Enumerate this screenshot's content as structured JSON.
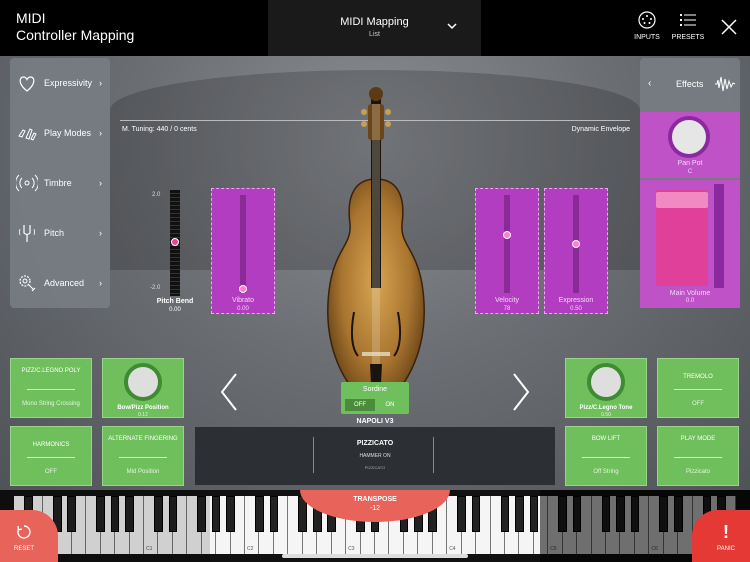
{
  "header": {
    "title_line1": "MIDI",
    "title_line2": "Controller Mapping",
    "mapping_title": "MIDI Mapping",
    "mapping_sub": "List",
    "inputs_label": "INPUTS",
    "presets_label": "PRESETS"
  },
  "left_panel": {
    "items": [
      {
        "label": "Expressivity",
        "icon": "heart-icon"
      },
      {
        "label": "Play Modes",
        "icon": "hands-icon"
      },
      {
        "label": "Timbre",
        "icon": "wave-radio-icon"
      },
      {
        "label": "Pitch",
        "icon": "tuning-fork-icon"
      },
      {
        "label": "Advanced",
        "icon": "advanced-gear-icon"
      }
    ]
  },
  "right_panel": {
    "title": "Effects",
    "panpot_label": "Pan Pot",
    "panpot_value": "C",
    "mainvol_label": "Main Volume",
    "mainvol_value": "0.0"
  },
  "stage": {
    "tuning": "M. Tuning: 440   / 0 cents",
    "dynamic_envelope": "Dynamic Envelope"
  },
  "pitch_bend": {
    "max": "2.0",
    "min": "-2.0",
    "label": "Pitch Bend",
    "value": "0.00"
  },
  "sliders": [
    {
      "label": "Vibrato",
      "value": "0.00",
      "level": 0.0
    },
    {
      "label": "Velocity",
      "value": "78",
      "level": 0.6
    },
    {
      "label": "Expression",
      "value": "0.50",
      "level": 0.5
    }
  ],
  "sordine": {
    "label": "Sordine",
    "off": "OFF",
    "on": "ON"
  },
  "preset_name": "NAPOLI V3",
  "left_buttons": [
    {
      "title": "PIZZ/C.LEGNO POLY",
      "value": "Mono String Crossing"
    },
    {
      "title": "HARMONICS",
      "value": "OFF"
    },
    {
      "title": "ALTERNATE FINGERING",
      "value": "Mid Position"
    }
  ],
  "left_knob": {
    "label": "Bow/Pizz Position",
    "value": "0.12"
  },
  "right_knob": {
    "label": "Pizz/C.Legno Tone",
    "value": "0.50"
  },
  "right_buttons": [
    {
      "title": "TREMOLO",
      "value": "OFF"
    },
    {
      "title": "BOW LIFT",
      "value": "Off String"
    },
    {
      "title": "PLAY MODE",
      "value": "Pizzicato"
    }
  ],
  "articulation": {
    "main": "PIZZICATO",
    "sub": "HAMMER ON",
    "small": "PIZZICATO"
  },
  "keyboard": {
    "transpose_label": "TRANSPOSE",
    "transpose_value": "-12",
    "c_labels": [
      "C0",
      "C1",
      "C2",
      "C3",
      "C4",
      "C5",
      "C6"
    ]
  },
  "reset_label": "RESET",
  "panic_label": "PANIC",
  "colors": {
    "accent_purple": "#b33dc0",
    "accent_green": "#6fbf5c",
    "panic_red": "#e53935",
    "transpose_red": "#e8645a"
  }
}
